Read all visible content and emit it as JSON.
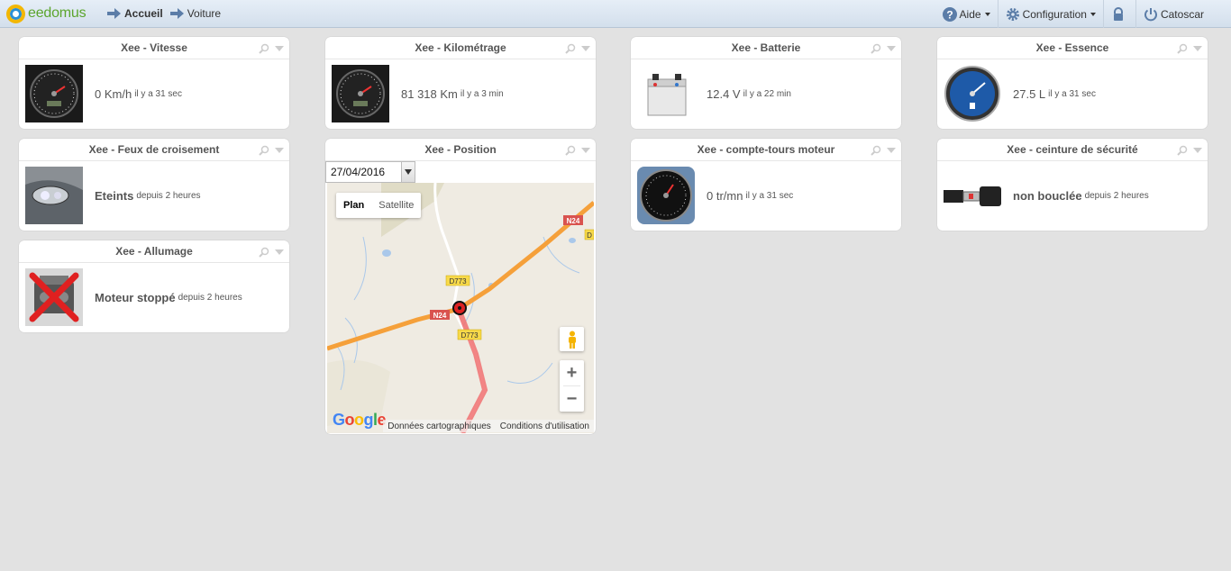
{
  "app": {
    "logo_text": "eedomus"
  },
  "breadcrumb": {
    "items": [
      "Accueil",
      "Voiture"
    ]
  },
  "topbar": {
    "help_label": "Aide",
    "config_label": "Configuration",
    "user_label": "Catoscar"
  },
  "widgets": {
    "vitesse": {
      "title": "Xee - Vitesse",
      "value": "0 Km/h",
      "time": "il y a 31 sec"
    },
    "kilometrage": {
      "title": "Xee - Kilométrage",
      "value": "81 318 Km",
      "time": "il y a 3 min"
    },
    "batterie": {
      "title": "Xee - Batterie",
      "value": "12.4 V",
      "time": "il y a 22 min"
    },
    "essence": {
      "title": "Xee - Essence",
      "value": "27.5 L",
      "time": "il y a 31 sec"
    },
    "feux": {
      "title": "Xee - Feux de croisement",
      "value": "Eteints",
      "time": "depuis 2 heures"
    },
    "position": {
      "title": "Xee - Position",
      "date": "27/04/2016",
      "map_type_plan": "Plan",
      "map_type_satellite": "Satellite",
      "road_labels": {
        "n24_a": "N24",
        "n24_b": "N24",
        "d773_a": "D773",
        "d773_b": "D773",
        "d_edge": "D"
      },
      "zoom_in": "+",
      "zoom_out": "−",
      "google": "Google",
      "map_data": "Données cartographiques",
      "terms": "Conditions d'utilisation"
    },
    "compte_tours": {
      "title": "Xee - compte-tours moteur",
      "value": "0 tr/mn",
      "time": "il y a 31 sec"
    },
    "ceinture": {
      "title": "Xee - ceinture de sécurité",
      "value": "non bouclée",
      "time": "depuis 2 heures"
    },
    "allumage": {
      "title": "Xee - Allumage",
      "value": "Moteur stoppé",
      "time": "depuis 2 heures"
    }
  },
  "colors": {
    "topbar": "#d3dfec",
    "background": "#e2e2e2",
    "logo_green": "#5ba52d",
    "route": "#f07070",
    "highway": "#f5a03a"
  }
}
